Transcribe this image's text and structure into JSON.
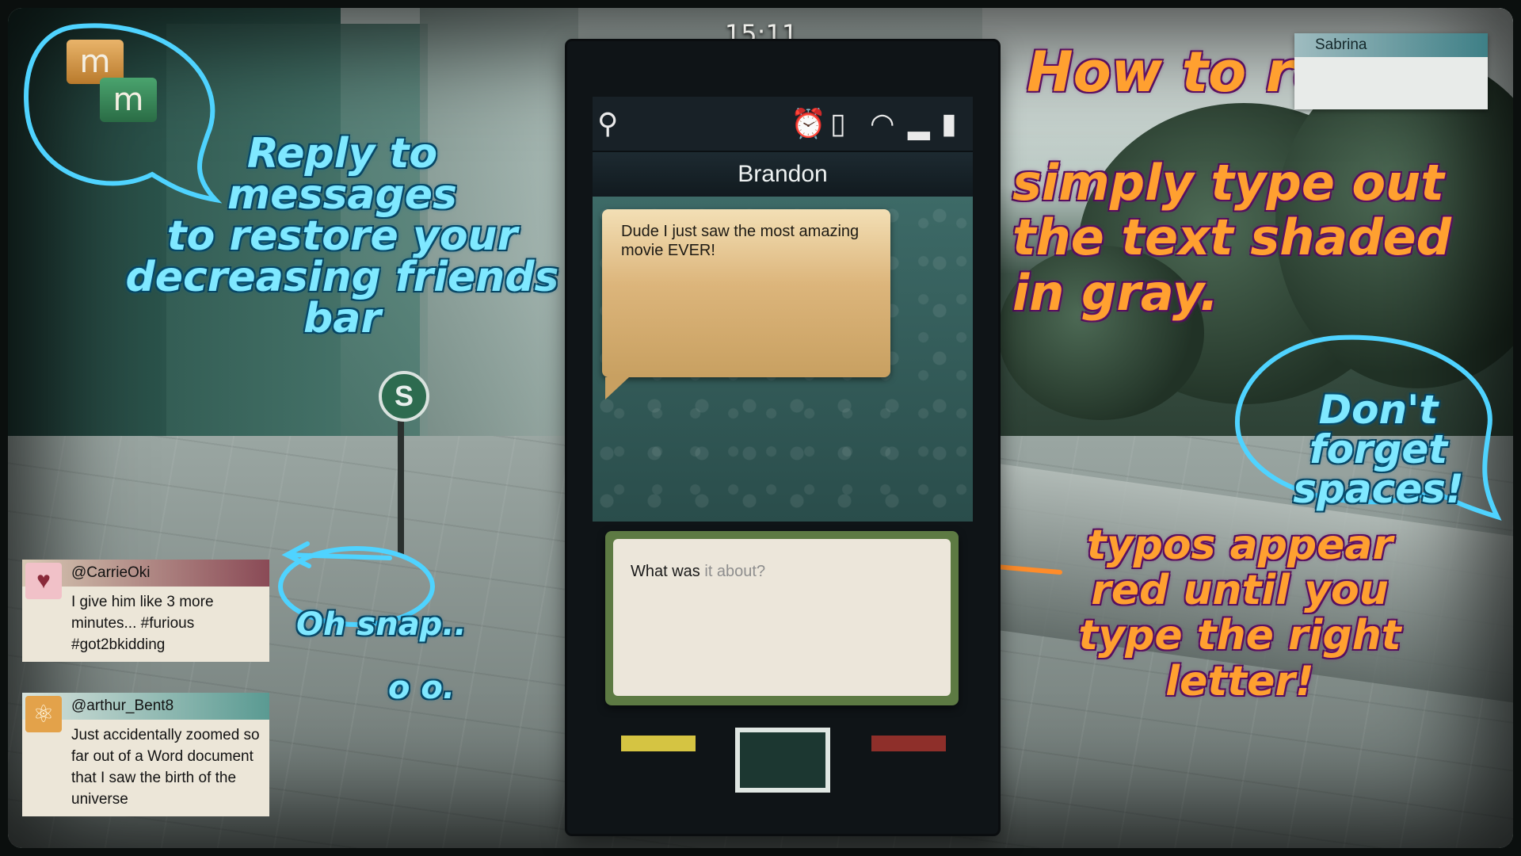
{
  "phone": {
    "time": "15:11",
    "status_icons": {
      "location": "location-pin-icon",
      "alarm": "alarm-clock-icon",
      "vibrate": "vibrate-icon",
      "wifi": "wifi-icon",
      "signal": "signal-bars-icon",
      "battery": "battery-icon"
    },
    "contact_name": "Brandon",
    "incoming_message": "Dude I just saw the most amazing movie EVER!",
    "reply_typed": "What was",
    "reply_remaining": " it about?"
  },
  "app_logo": {
    "letter_a": "m",
    "letter_b": "m"
  },
  "annotations": {
    "left_reply": "Reply  to\nmessages\nto restore  your\ndecreasing  friends bar",
    "oh_snap": "Oh snap..",
    "oh_snap_tail": "o o.",
    "how_to_title": "How to reply:",
    "how_to_body": "simply type out\nthe text shaded\nin gray.",
    "spaces": "Don't forget\nspaces!",
    "typos": "typos appear\nred  until you\ntype the  right\nletter!"
  },
  "tweets": [
    {
      "handle": "@CarrieOki",
      "text": "I give him like 3 more minutes... #furious #got2bkidding",
      "avatar_icon": "heart-cat-icon"
    },
    {
      "handle": "@arthur_Bent8",
      "text": "Just accidentally zoomed so far out of a Word document that I saw the birth of the universe",
      "avatar_icon": "atom-icon"
    }
  ],
  "sabrina_panel": {
    "name": "Sabrina"
  },
  "colors": {
    "annotation_cyan": "#7fe8ff",
    "annotation_orange": "#ffa030",
    "message_bubble": "#dcb57b",
    "reply_frame": "#5d7a43"
  }
}
